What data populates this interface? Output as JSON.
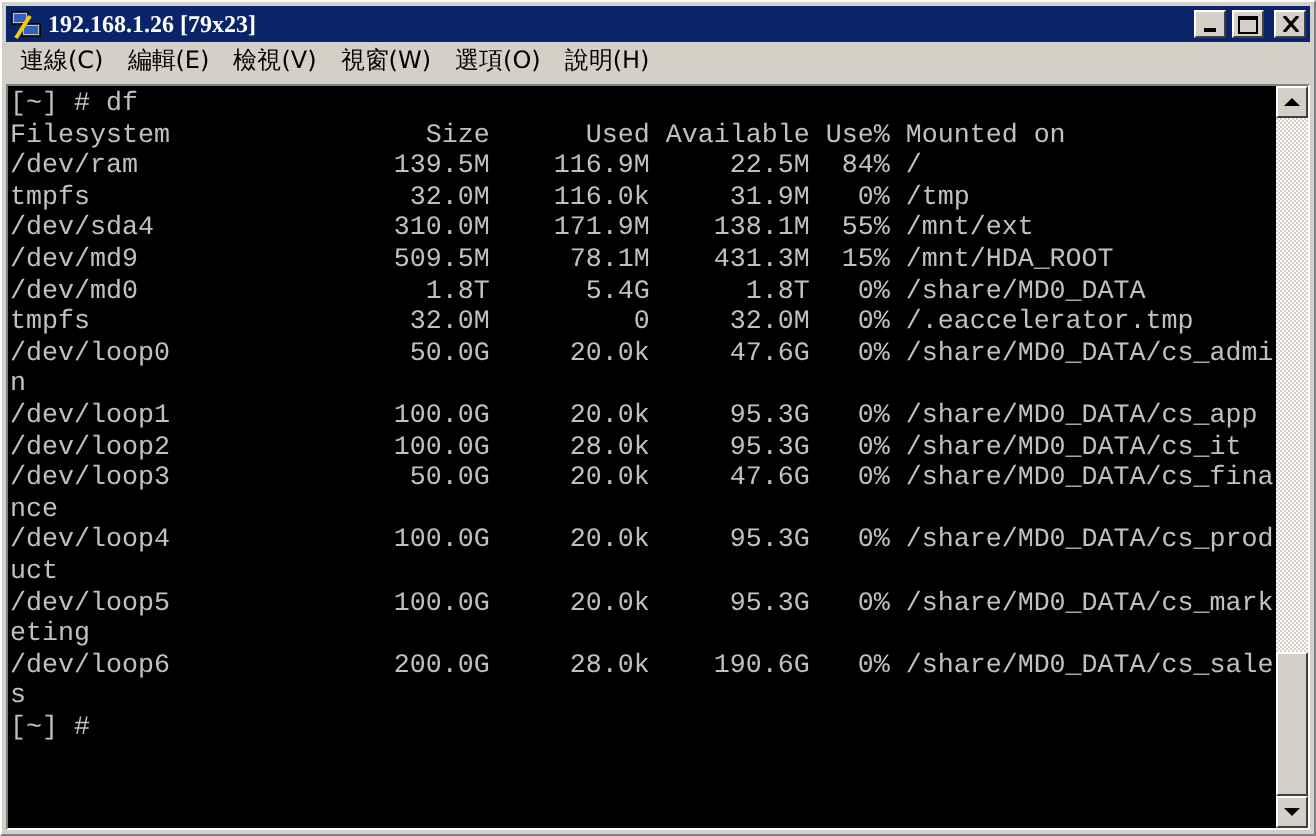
{
  "window": {
    "title": "192.168.1.26 [79x23]"
  },
  "menu": [
    {
      "label": "連線(C)"
    },
    {
      "label": "編輯(E)"
    },
    {
      "label": "檢視(V)"
    },
    {
      "label": "視窗(W)"
    },
    {
      "label": "選項(O)"
    },
    {
      "label": "說明(H)"
    }
  ],
  "terminal": {
    "lines": [
      {
        "kind": "prompt",
        "text": "[~] # df"
      },
      {
        "kind": "row",
        "cells": [
          "Filesystem",
          "Size",
          "Used",
          "Available",
          "Use%",
          "Mounted on"
        ]
      },
      {
        "kind": "row",
        "cells": [
          "/dev/ram",
          "139.5M",
          "116.9M",
          "22.5M",
          "84%",
          "/"
        ]
      },
      {
        "kind": "row",
        "cells": [
          "tmpfs",
          "32.0M",
          "116.0k",
          "31.9M",
          "0%",
          "/tmp"
        ]
      },
      {
        "kind": "row",
        "cells": [
          "/dev/sda4",
          "310.0M",
          "171.9M",
          "138.1M",
          "55%",
          "/mnt/ext"
        ]
      },
      {
        "kind": "row",
        "cells": [
          "/dev/md9",
          "509.5M",
          "78.1M",
          "431.3M",
          "15%",
          "/mnt/HDA_ROOT"
        ]
      },
      {
        "kind": "row",
        "cells": [
          "/dev/md0",
          "1.8T",
          "5.4G",
          "1.8T",
          "0%",
          "/share/MD0_DATA"
        ]
      },
      {
        "kind": "row",
        "cells": [
          "tmpfs",
          "32.0M",
          "0",
          "32.0M",
          "0%",
          "/.eaccelerator.tmp"
        ]
      },
      {
        "kind": "row",
        "cells": [
          "/dev/loop0",
          "50.0G",
          "20.0k",
          "47.6G",
          "0%",
          "/share/MD0_DATA/cs_admi"
        ]
      },
      {
        "kind": "text",
        "text": "n"
      },
      {
        "kind": "row",
        "cells": [
          "/dev/loop1",
          "100.0G",
          "20.0k",
          "95.3G",
          "0%",
          "/share/MD0_DATA/cs_app"
        ]
      },
      {
        "kind": "row",
        "cells": [
          "/dev/loop2",
          "100.0G",
          "28.0k",
          "95.3G",
          "0%",
          "/share/MD0_DATA/cs_it"
        ]
      },
      {
        "kind": "row",
        "cells": [
          "/dev/loop3",
          "50.0G",
          "20.0k",
          "47.6G",
          "0%",
          "/share/MD0_DATA/cs_fina"
        ]
      },
      {
        "kind": "text",
        "text": "nce"
      },
      {
        "kind": "row",
        "cells": [
          "/dev/loop4",
          "100.0G",
          "20.0k",
          "95.3G",
          "0%",
          "/share/MD0_DATA/cs_prod"
        ]
      },
      {
        "kind": "text",
        "text": "uct"
      },
      {
        "kind": "row",
        "cells": [
          "/dev/loop5",
          "100.0G",
          "20.0k",
          "95.3G",
          "0%",
          "/share/MD0_DATA/cs_mark"
        ]
      },
      {
        "kind": "text",
        "text": "eting"
      },
      {
        "kind": "row",
        "cells": [
          "/dev/loop6",
          "200.0G",
          "28.0k",
          "190.6G",
          "0%",
          "/share/MD0_DATA/cs_sale"
        ]
      },
      {
        "kind": "text",
        "text": "s"
      },
      {
        "kind": "prompt",
        "text": "[~] #"
      }
    ]
  }
}
